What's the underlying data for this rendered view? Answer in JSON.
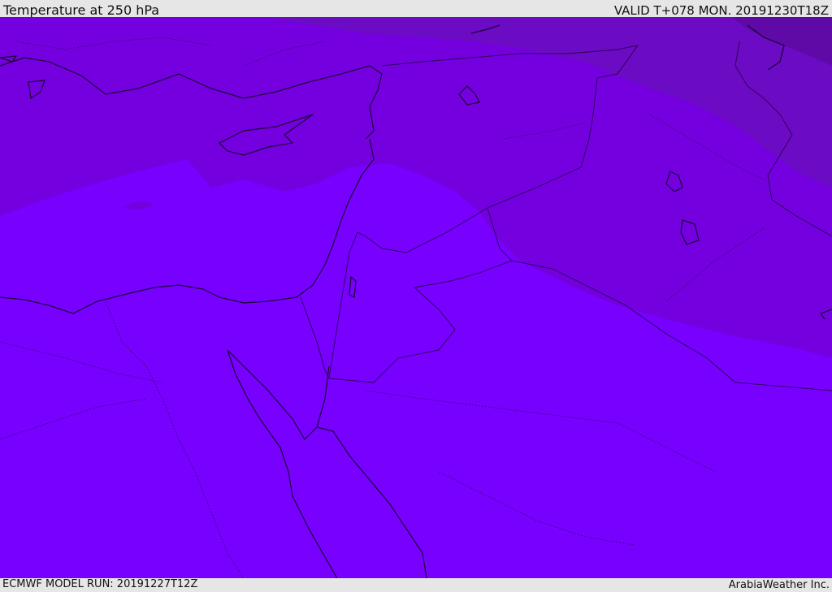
{
  "header": {
    "title": "Temperature at 250 hPa",
    "valid": "VALID T+078 MON. 20191230T18Z"
  },
  "footer": {
    "model_run": "ECMWF MODEL RUN: 20191227T12Z",
    "credit": "ArabiaWeather Inc."
  },
  "map": {
    "colors": {
      "warm_band": "#7700ff",
      "mid_band": "#7400e0",
      "cold_band": "#6c0bc4",
      "coldest_band": "#5f0aa6",
      "coastline": "#1a0033",
      "border": "#2a0050"
    }
  }
}
